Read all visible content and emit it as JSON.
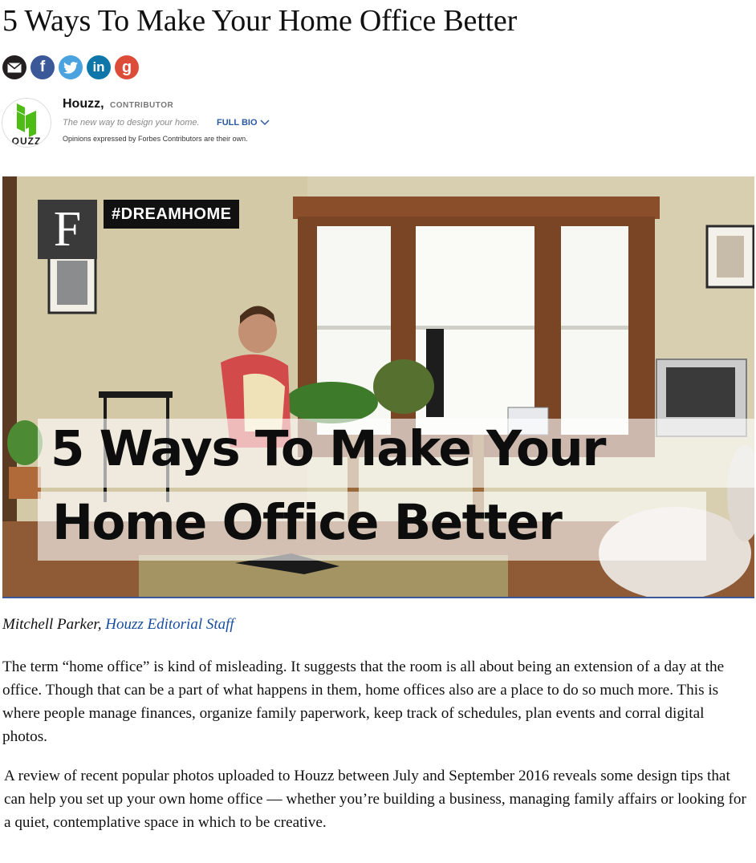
{
  "article": {
    "title": "5 Ways To Make Your Home Office Better"
  },
  "share": {
    "facebook_glyph": "f",
    "linkedin_glyph": "in",
    "google_glyph": "g"
  },
  "author": {
    "name": "Houzz,",
    "role": "CONTRIBUTOR",
    "tagline": "The new way to design your home.",
    "full_bio_label": "FULL BIO",
    "disclaimer": "Opinions expressed by Forbes Contributors are their own.",
    "avatar_word": "OUZZ",
    "brand_color": "#4dbc15"
  },
  "hero": {
    "logo_letter": "F",
    "tag": "#DREAMHOME",
    "overlay_line1": "5 Ways To Make Your",
    "overlay_line2": "Home Office Better"
  },
  "byline": {
    "author": "Mitchell Parker,",
    "affiliation": "Houzz Editorial Staff"
  },
  "body": {
    "paragraph1": "The term “home office” is kind of misleading. It suggests that the room is all about being an extension of a day at the office. Though that can be a part of what happens in them, home offices also are a place to do so much more. This is where people manage finances, organize family paperwork, keep track of schedules, plan events and corral digital photos.",
    "paragraph2": "A review of recent popular photos uploaded to Houzz between July and September 2016 reveals some design tips that can help you set up your own home office — whether you’re building a business, managing family affairs or looking for a quiet, contemplative space in which to be creative."
  },
  "colors": {
    "link": "#1a4fa0",
    "full_bio": "#2c5aa0",
    "email": "#231f20",
    "facebook": "#3b5998",
    "twitter": "#4aa3df",
    "linkedin": "#0e76a8",
    "google": "#dd4b39"
  }
}
